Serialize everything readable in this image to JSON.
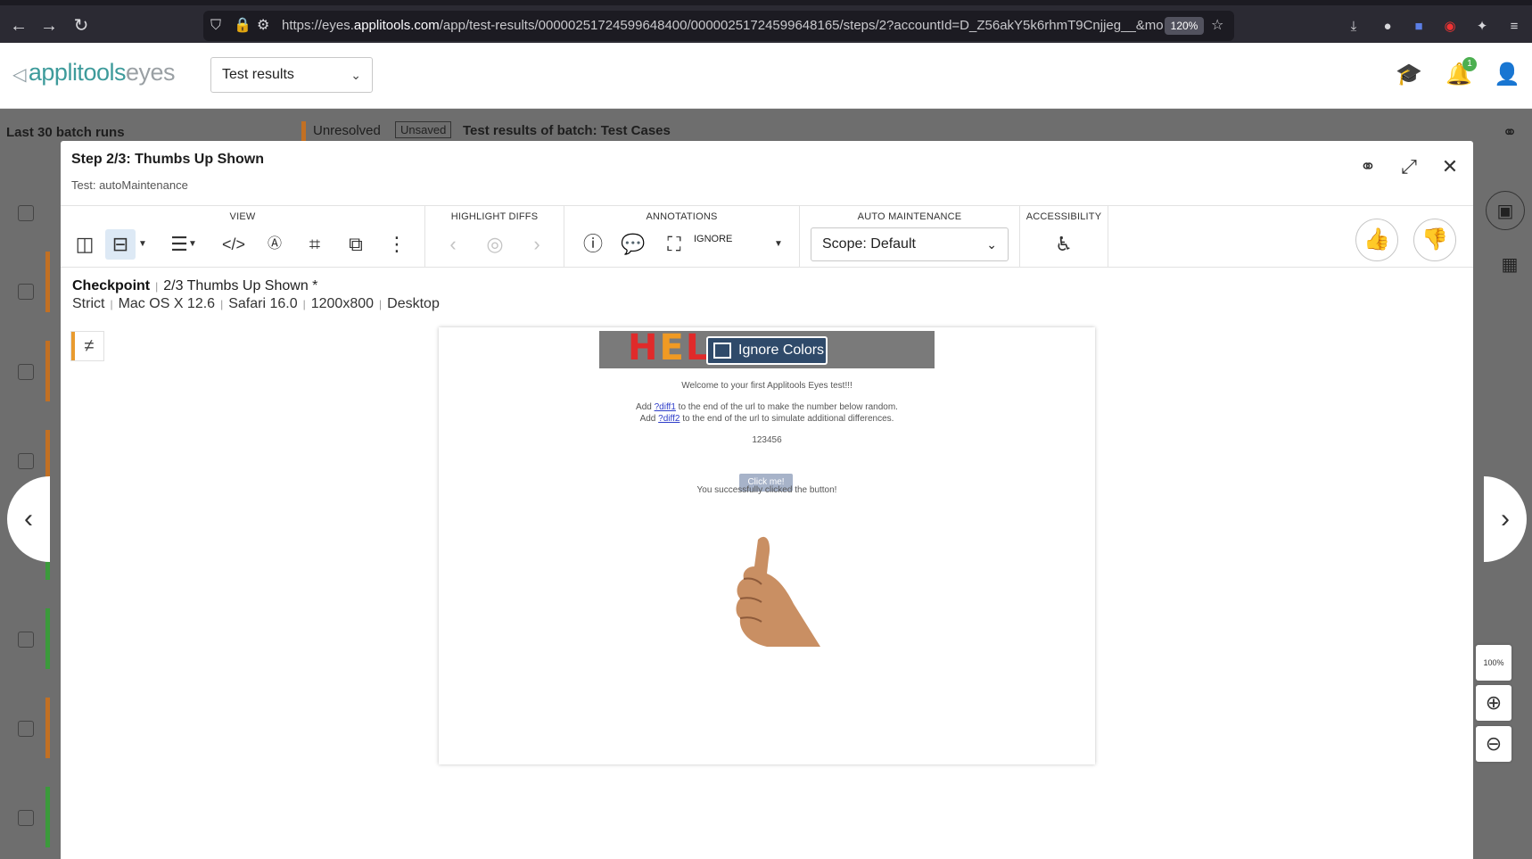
{
  "browser": {
    "url_prefix": "https://eyes.",
    "url_domain": "applitools.com",
    "url_path": "/app/test-results/00000251724599648400/00000251724599648165/steps/2?accountId=D_Z56akY5k6rhmT9Cnjjeg__&mo",
    "zoom": "120%"
  },
  "app": {
    "logo_a": "applitools",
    "logo_e": "eyes",
    "view_select": "Test results",
    "notification_count": "1"
  },
  "background": {
    "sidebar_title": "Last 30 batch runs",
    "status": "Unresolved",
    "unsaved": "Unsaved",
    "batch_title": "Test results of batch:  Test Cases"
  },
  "modal": {
    "title": "Step 2/3:  Thumbs Up Shown",
    "subtitle": "Test: autoMaintenance",
    "sections": {
      "view": "VIEW",
      "highlight": "HIGHLIGHT DIFFS",
      "annotations": "ANNOTATIONS",
      "auto_maintenance": "AUTO MAINTENANCE",
      "accessibility": "ACCESSIBILITY"
    },
    "ignore_label": "IGNORE",
    "scope": "Scope: Default",
    "checkpoint_label": "Checkpoint",
    "checkpoint_name": "2/3 Thumbs Up Shown *",
    "env": [
      "Strict",
      "Mac OS X 12.6",
      "Safari 16.0",
      "1200x800",
      "Desktop"
    ],
    "diff_symbol": "≠"
  },
  "screenshot": {
    "ignore_region_label": "Ignore Colors",
    "welcome": "Welcome to your first Applitools Eyes test!!!",
    "line1_pre": "Add ",
    "line1_link": "?diff1",
    "line1_post": " to the end of the url to make the number below random.",
    "line2_pre": "Add ",
    "line2_link": "?diff2",
    "line2_post": " to the end of the url to simulate additional differences.",
    "number": "123456",
    "button": "Click me!",
    "clicked": "You successfully clicked the button!"
  },
  "zoom_controls": {
    "fit": "100%"
  }
}
